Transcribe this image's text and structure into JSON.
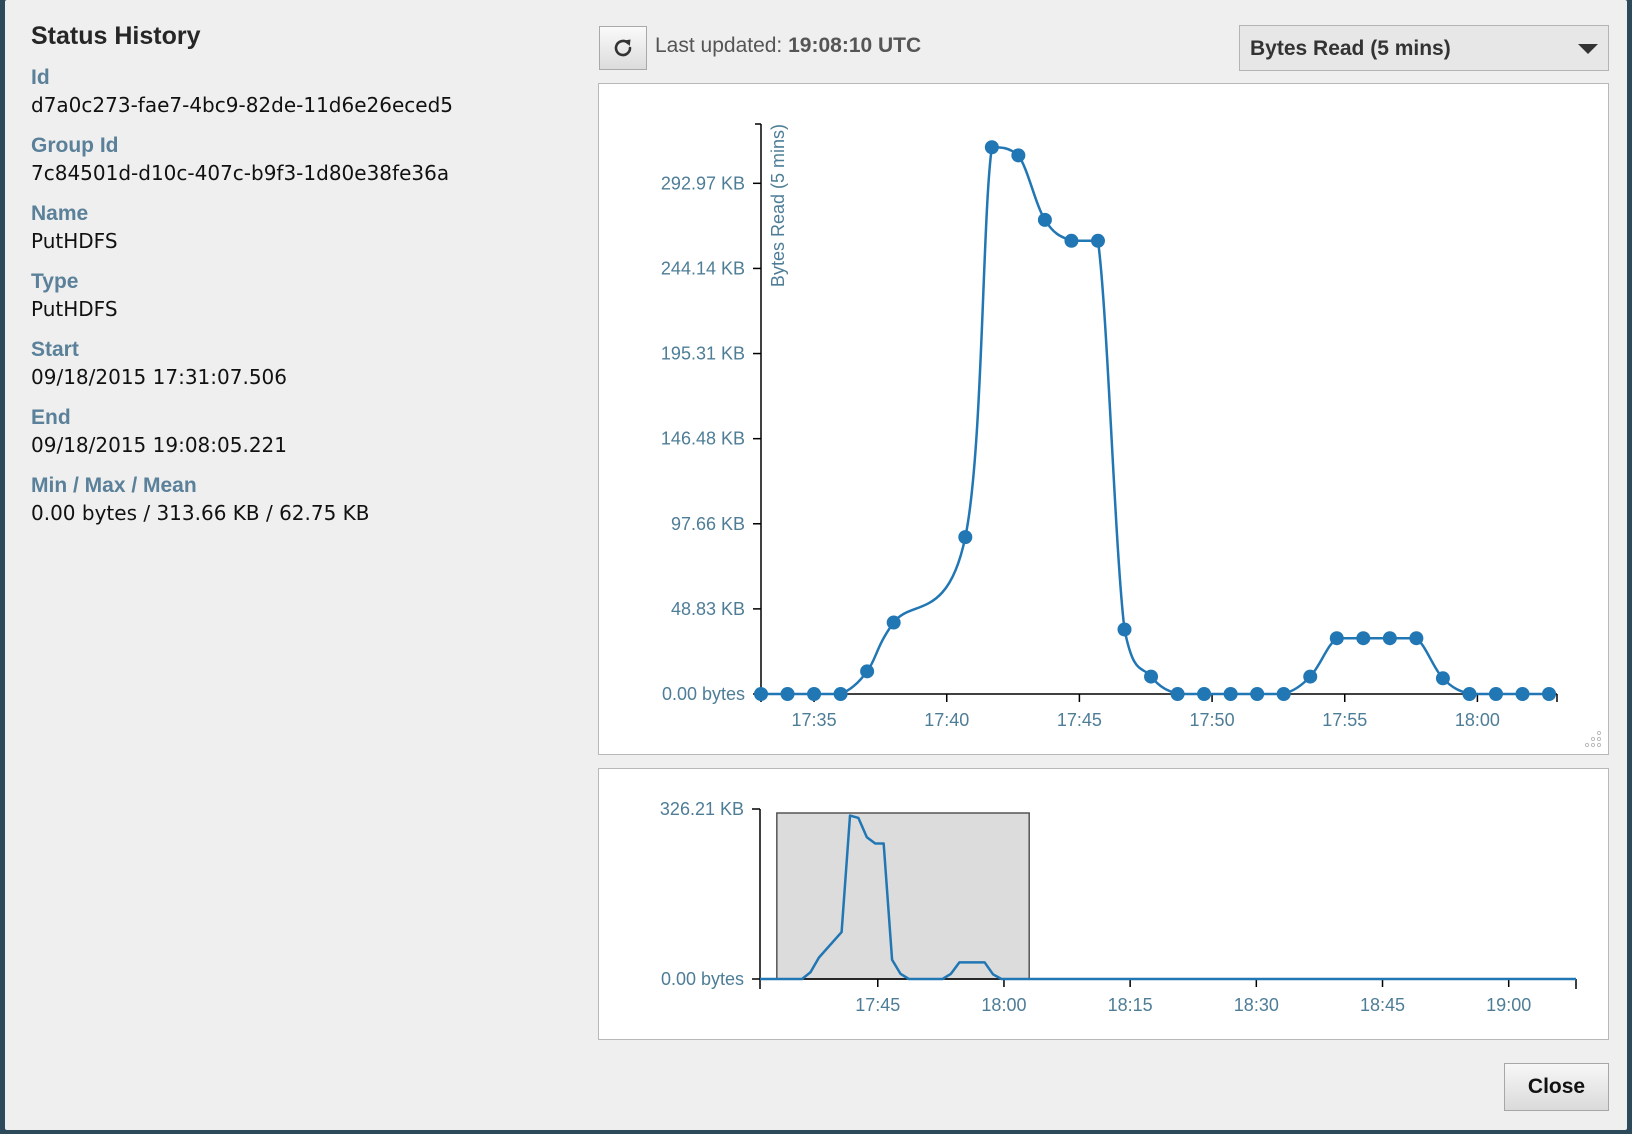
{
  "dialog": {
    "title": "Status History",
    "fields": [
      {
        "label": "Id",
        "value": "d7a0c273-fae7-4bc9-82de-11d6e26eced5"
      },
      {
        "label": "Group Id",
        "value": "7c84501d-d10c-407c-b9f3-1d80e38fe36a"
      },
      {
        "label": "Name",
        "value": "PutHDFS"
      },
      {
        "label": "Type",
        "value": "PutHDFS"
      },
      {
        "label": "Start",
        "value": "09/18/2015 17:31:07.506"
      },
      {
        "label": "End",
        "value": "09/18/2015 19:08:05.221"
      },
      {
        "label": "Min / Max / Mean",
        "value": "0.00 bytes / 313.66 KB / 62.75 KB"
      }
    ],
    "close_label": "Close"
  },
  "toolbar": {
    "last_updated_label": "Last updated:",
    "last_updated_value": "19:08:10 UTC",
    "refresh_icon": "refresh-icon",
    "selected_metric": "Bytes Read (5 mins)"
  },
  "colors": {
    "series": "#2176b4",
    "axis_text": "#4e7d97",
    "brush": "#dcdcdc"
  },
  "chart_data": [
    {
      "type": "line",
      "ylabel": "Bytes Read (5 mins)",
      "y_unit": "KB",
      "ylim": [
        0,
        327
      ],
      "xlim": [
        "17:33",
        "18:03"
      ],
      "y_ticks": [
        "0.00 bytes",
        "48.83 KB",
        "97.66 KB",
        "146.48 KB",
        "195.31 KB",
        "244.14 KB",
        "292.97 KB"
      ],
      "y_tick_values": [
        0,
        48.83,
        97.66,
        146.48,
        195.31,
        244.14,
        292.97
      ],
      "x_ticks": [
        "17:35",
        "17:40",
        "17:45",
        "17:50",
        "17:55",
        "18:00"
      ],
      "markers": true,
      "series": [
        {
          "x": [
            "17:33",
            "17:34",
            "17:35",
            "17:36",
            "17:37",
            "17:38",
            "17:40.7",
            "17:41.7",
            "17:42.7",
            "17:43.7",
            "17:44.7",
            "17:45.7",
            "17:46.7",
            "17:47.7",
            "17:48.7",
            "17:49.7",
            "17:50.7",
            "17:51.7",
            "17:52.7",
            "17:53.7",
            "17:54.7",
            "17:55.7",
            "17:56.7",
            "17:57.7",
            "17:58.7",
            "17:59.7",
            "18:00.7",
            "18:01.7",
            "18:02.7"
          ],
          "y": [
            0,
            0,
            0,
            0,
            13,
            41,
            90,
            313.66,
            309,
            272,
            260,
            260,
            37,
            10,
            0,
            0,
            0,
            0,
            0,
            10,
            32,
            32,
            32,
            32,
            9,
            0,
            0,
            0,
            0
          ]
        }
      ]
    },
    {
      "type": "line",
      "role": "overview",
      "ylim": [
        0,
        326.21
      ],
      "xlim": [
        "17:31",
        "19:08"
      ],
      "y_ticks": [
        "0.00 bytes",
        "326.21 KB"
      ],
      "y_tick_values": [
        0,
        326.21
      ],
      "x_ticks": [
        "17:45",
        "18:00",
        "18:15",
        "18:30",
        "18:45",
        "19:00"
      ],
      "brush": [
        "17:33",
        "18:03"
      ]
    }
  ]
}
